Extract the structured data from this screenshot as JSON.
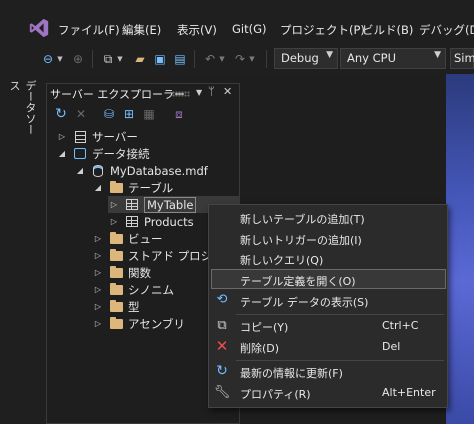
{
  "menu": {
    "items": [
      "ファイル(F)",
      "編集(E)",
      "表示(V)",
      "Git(G)",
      "プロジェクト(P)",
      "ビルド(B)",
      "デバッグ(D)"
    ]
  },
  "toolbar": {
    "config_combo": "Debug",
    "platform_combo": "Any CPU",
    "start_combo": "Sim"
  },
  "side_tab": {
    "label": "データソース"
  },
  "panel": {
    "title": "サーバー エクスプローラー",
    "pin_glyph": "ᛘ",
    "close_glyph": "✕"
  },
  "tree": {
    "servers": "サーバー",
    "data_connections": "データ接続",
    "database": "MyDatabase.mdf",
    "tables": "テーブル",
    "mytable": "MyTable",
    "products": "Products",
    "views": "ビュー",
    "procedures": "ストアド プロシージ",
    "functions": "関数",
    "synonyms": "シノニム",
    "types": "型",
    "assemblies": "アセンブリ"
  },
  "context_menu": {
    "add_table": "新しいテーブルの追加(T)",
    "add_trigger": "新しいトリガーの追加(I)",
    "new_query": "新しいクエリ(Q)",
    "open_definition": "テーブル定義を開く(O)",
    "show_data": "テーブル データの表示(S)",
    "copy": "コピー(Y)",
    "copy_shortcut": "Ctrl+C",
    "delete": "削除(D)",
    "delete_shortcut": "Del",
    "refresh": "最新の情報に更新(F)",
    "properties": "プロパティ(R)",
    "properties_shortcut": "Alt+Enter"
  },
  "colors": {
    "accent_blue": "#75beff",
    "delete_red": "#f14c4c",
    "folder": "#dcb67a",
    "vs_purple": "#a074c4"
  }
}
